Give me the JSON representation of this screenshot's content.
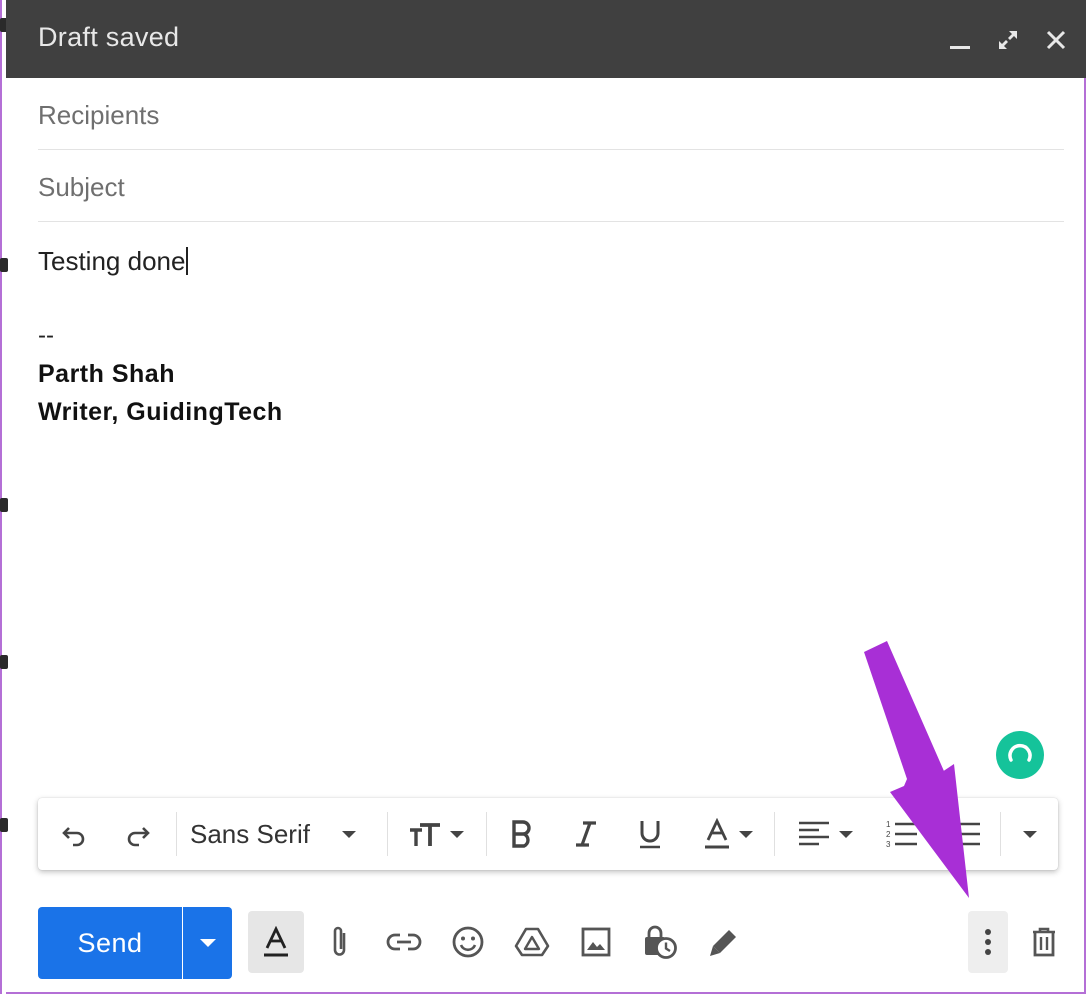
{
  "window": {
    "title": "Draft saved",
    "controls": [
      "minimize-icon",
      "expand-icon",
      "close-icon"
    ]
  },
  "fields": {
    "recipients_placeholder": "Recipients",
    "subject_placeholder": "Subject"
  },
  "body": {
    "text": "Testing done",
    "signature_separator": "--",
    "signature_name": "Parth Shah",
    "signature_title": "Writer, GuidingTech"
  },
  "toolbar": {
    "font": "Sans Serif",
    "tools": [
      "undo-icon",
      "redo-icon",
      "font-select",
      "text-size-icon",
      "bold-icon",
      "italic-icon",
      "underline-icon",
      "text-color-icon",
      "align-icon",
      "numbered-list-icon",
      "bulleted-list-icon",
      "more-formatting-icon"
    ]
  },
  "bottom": {
    "send_label": "Send",
    "actions": [
      "formatting-options-icon",
      "attach-icon",
      "link-icon",
      "emoji-icon",
      "drive-icon",
      "photo-icon",
      "confidential-icon",
      "signature-icon",
      "more-options-icon",
      "discard-icon"
    ]
  },
  "colors": {
    "titlebar": "#404040",
    "send": "#1a73e8",
    "grammarly": "#15c39a",
    "annotation_arrow": "#a82fd6",
    "frame_border": "#b46fd6"
  }
}
